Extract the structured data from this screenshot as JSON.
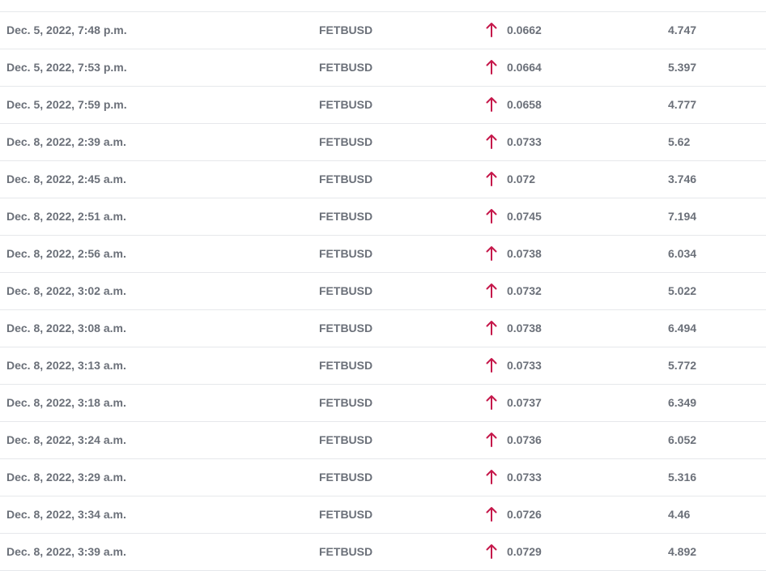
{
  "accent_color": "#c5174a",
  "trend_icon": "arrow-up-icon",
  "rows": [
    {
      "time": "Dec. 5, 2022, 7:48 p.m.",
      "symbol": "FETBUSD",
      "price": "0.0662",
      "volume": "4.747"
    },
    {
      "time": "Dec. 5, 2022, 7:53 p.m.",
      "symbol": "FETBUSD",
      "price": "0.0664",
      "volume": "5.397"
    },
    {
      "time": "Dec. 5, 2022, 7:59 p.m.",
      "symbol": "FETBUSD",
      "price": "0.0658",
      "volume": "4.777"
    },
    {
      "time": "Dec. 8, 2022, 2:39 a.m.",
      "symbol": "FETBUSD",
      "price": "0.0733",
      "volume": "5.62"
    },
    {
      "time": "Dec. 8, 2022, 2:45 a.m.",
      "symbol": "FETBUSD",
      "price": "0.072",
      "volume": "3.746"
    },
    {
      "time": "Dec. 8, 2022, 2:51 a.m.",
      "symbol": "FETBUSD",
      "price": "0.0745",
      "volume": "7.194"
    },
    {
      "time": "Dec. 8, 2022, 2:56 a.m.",
      "symbol": "FETBUSD",
      "price": "0.0738",
      "volume": "6.034"
    },
    {
      "time": "Dec. 8, 2022, 3:02 a.m.",
      "symbol": "FETBUSD",
      "price": "0.0732",
      "volume": "5.022"
    },
    {
      "time": "Dec. 8, 2022, 3:08 a.m.",
      "symbol": "FETBUSD",
      "price": "0.0738",
      "volume": "6.494"
    },
    {
      "time": "Dec. 8, 2022, 3:13 a.m.",
      "symbol": "FETBUSD",
      "price": "0.0733",
      "volume": "5.772"
    },
    {
      "time": "Dec. 8, 2022, 3:18 a.m.",
      "symbol": "FETBUSD",
      "price": "0.0737",
      "volume": "6.349"
    },
    {
      "time": "Dec. 8, 2022, 3:24 a.m.",
      "symbol": "FETBUSD",
      "price": "0.0736",
      "volume": "6.052"
    },
    {
      "time": "Dec. 8, 2022, 3:29 a.m.",
      "symbol": "FETBUSD",
      "price": "0.0733",
      "volume": "5.316"
    },
    {
      "time": "Dec. 8, 2022, 3:34 a.m.",
      "symbol": "FETBUSD",
      "price": "0.0726",
      "volume": "4.46"
    },
    {
      "time": "Dec. 8, 2022, 3:39 a.m.",
      "symbol": "FETBUSD",
      "price": "0.0729",
      "volume": "4.892"
    }
  ]
}
